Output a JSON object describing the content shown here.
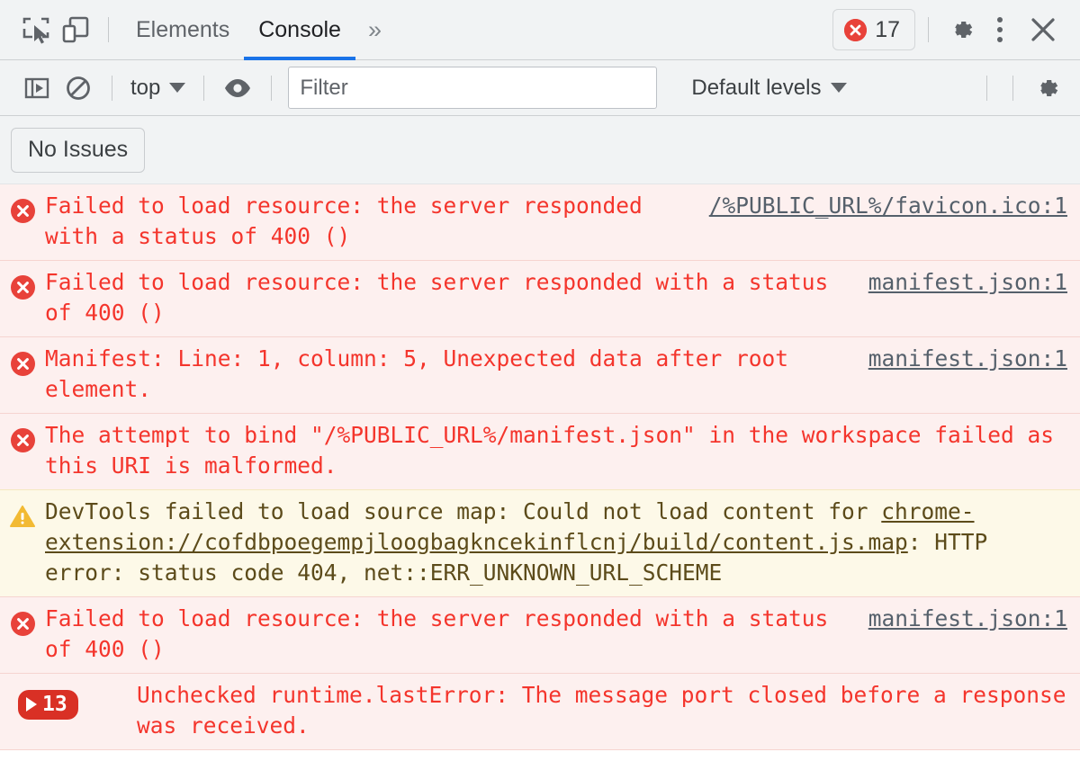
{
  "window": {
    "app": "Chrome DevTools"
  },
  "toolbar": {
    "inspect_icon": "inspect-element-icon",
    "device_icon": "device-toolbar-icon",
    "tabs": [
      {
        "label": "Elements",
        "selected": false
      },
      {
        "label": "Console",
        "selected": true
      }
    ],
    "more_tabs_label": "»",
    "error_count": "17",
    "error_badge_icon": "error-circle-icon",
    "settings_icon": "gear-icon",
    "menu_icon": "kebab-menu-icon",
    "close_icon": "close-icon"
  },
  "console_toolbar": {
    "sidebar_icon": "console-sidebar-icon",
    "clear_icon": "clear-console-icon",
    "context_label": "top",
    "eye_icon": "live-expression-icon",
    "filter_placeholder": "Filter",
    "filter_value": "",
    "levels_label": "Default levels",
    "settings_icon": "gear-icon"
  },
  "issues_bar": {
    "label": "No Issues"
  },
  "console": {
    "messages": [
      {
        "level": "error",
        "icon": "error-circle-icon",
        "text": "Failed to load resource: the server responded with a status of 400 ()",
        "source": "/%PUBLIC_URL%/favicon.ico:1",
        "repeat": null
      },
      {
        "level": "error",
        "icon": "error-circle-icon",
        "text": "Failed to load resource: the server responded with a status of 400 ()",
        "source": "manifest.json:1",
        "repeat": null
      },
      {
        "level": "error",
        "icon": "error-circle-icon",
        "text": "Manifest: Line: 1, column: 5, Unexpected data after root element.",
        "source": "manifest.json:1",
        "repeat": null
      },
      {
        "level": "error",
        "icon": "error-circle-icon",
        "text": "The attempt to bind \"/%PUBLIC_URL%/manifest.json\" in the workspace failed as this URI is malformed.",
        "source": "",
        "repeat": null
      },
      {
        "level": "warning",
        "icon": "warning-triangle-icon",
        "text_before": "DevTools failed to load source map: Could not load content for ",
        "link": "chrome-extension://cofdbpoegempjloogbagkncekinflcnj/build/content.js.map",
        "text_after": ": HTTP error: status code 404, net::ERR_UNKNOWN_URL_SCHEME",
        "source": "",
        "repeat": null
      },
      {
        "level": "error",
        "icon": "error-circle-icon",
        "text": "Failed to load resource: the server responded with a status of 400 ()",
        "source": "manifest.json:1",
        "repeat": null
      },
      {
        "level": "error",
        "icon": "group-count-badge",
        "text": "Unchecked runtime.lastError: The message port closed before a response was received.",
        "source": "",
        "repeat": "13"
      }
    ]
  },
  "colors": {
    "toolbar_bg": "#f1f3f4",
    "tab_accent": "#1a73e8",
    "error_text": "#f4352c",
    "error_bg": "#fdf0ef",
    "warning_bg": "#fdf9e8",
    "warning_text": "#5c4b1a",
    "error_badge": "#e8423a",
    "warning_icon": "#f2ba33",
    "source_link": "#55606b",
    "group_badge_bg": "#d93025"
  }
}
